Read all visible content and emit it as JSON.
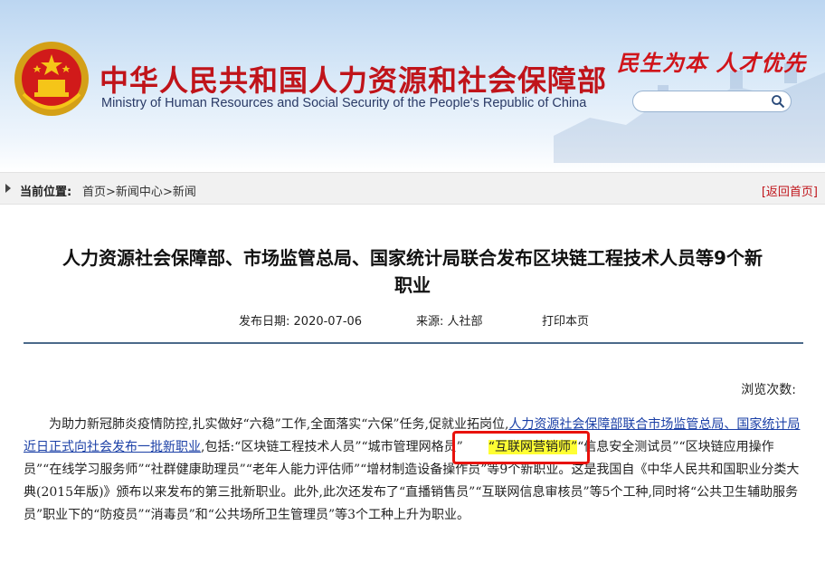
{
  "header": {
    "cn_title": "中华人民共和国人力资源和社会保障部",
    "en_title": "Ministry of Human Resources and Social Security of the People's Republic of China",
    "slogan": "民生为本  人才优先",
    "search_placeholder": "",
    "colors": {
      "title_red": "#c0141a",
      "header_blue": "#bcd6f1"
    }
  },
  "breadcrumb": {
    "label": "当前位置:",
    "items": [
      "首页",
      "新闻中心",
      "新闻"
    ],
    "separator": ">",
    "back_home": "[返回首页]"
  },
  "article": {
    "title_line1": "人力资源社会保障部、市场监管总局、国家统计局联合发布区块链工程技术人员等9个新",
    "title_line2": "职业",
    "publish_label": "发布日期:",
    "publish_date": "2020-07-06",
    "source_label": "来源:",
    "source": "人社部",
    "print": "打印本页",
    "views_label": "浏览次数:",
    "para_part1": "为助力新冠肺炎疫情防控,扎实做好“六稳”工作,全面落实“六保”任务,促就业拓岗位,",
    "para_link": "人力资源社会保障部联合市场监管总局、国家统计局近日正式向社会发布一批新职业",
    "para_part2": ",包括:“区块链工程技术人员”“城市管理网格员”",
    "para_highlight": "“互联网营销师”",
    "para_part3": "“信息安全测试员”“区块链应用操作员”“在线学习服务师”“社群健康助理员”“老年人能力评估师”“增材制造设备操作员”等9个新职业。这是我国自《中华人民共和国职业分类大典(2015年版)》颁布以来发布的第三批新职业。此外,此次还发布了“直播销售员”“互联网信息审核员”等5个工种,同时将“公共卫生辅助服务员”职业下的“防疫员”“消毒员”和“公共场所卫生管理员”等3个工种上升为职业。"
  },
  "icons": {
    "search": "search-icon",
    "emblem": "national-emblem-icon",
    "arrow": "triangle-right-icon"
  }
}
